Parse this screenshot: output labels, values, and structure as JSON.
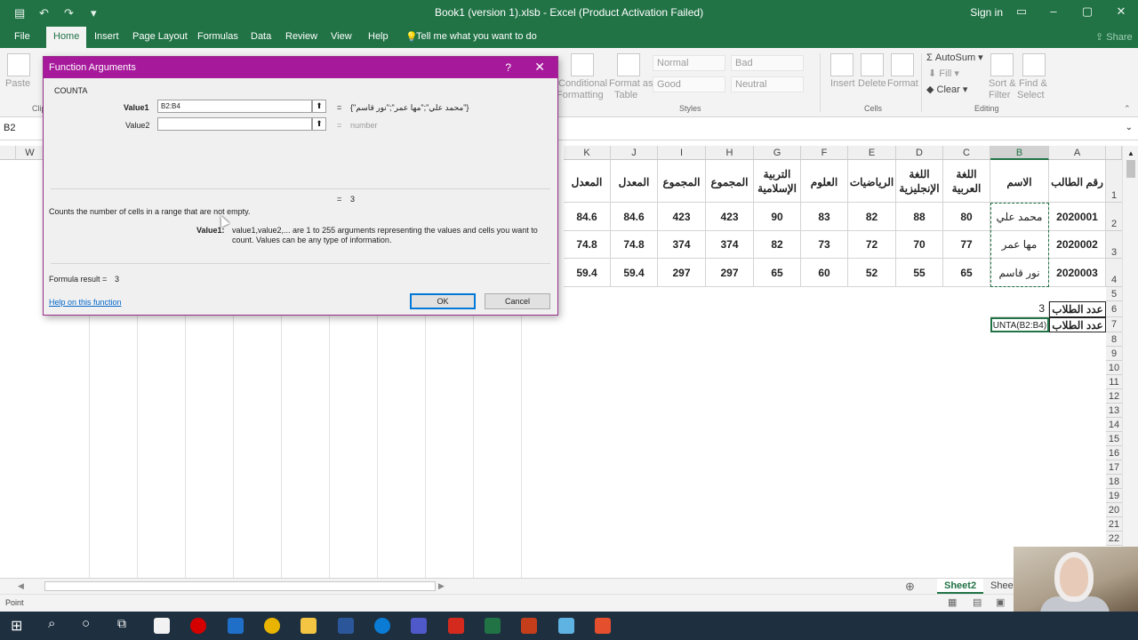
{
  "window": {
    "title": "Book1 (version 1).xlsb  -  Excel (Product Activation Failed)",
    "sign_in": "Sign in"
  },
  "ribbon": {
    "tabs": [
      "File",
      "Home",
      "Insert",
      "Page Layout",
      "Formulas",
      "Data",
      "Review",
      "View",
      "Help"
    ],
    "active_tab": "Home",
    "tell_me": "Tell me what you want to do",
    "share": "Share",
    "paste": "Paste",
    "clipboard_group": "Clip",
    "conditional": "Conditional",
    "formatting": "Formatting",
    "format_as": "Format as",
    "table": "Table",
    "styles": {
      "normal": "Normal",
      "bad": "Bad",
      "good": "Good",
      "neutral": "Neutral",
      "group": "Styles"
    },
    "insert": "Insert",
    "delete": "Delete",
    "format": "Format",
    "cells_group": "Cells",
    "autosum": "AutoSum",
    "fill": "Fill",
    "clear": "Clear",
    "sort_filter_1": "Sort &",
    "sort_filter_2": "Filter",
    "find_select_1": "Find &",
    "find_select_2": "Select",
    "editing_group": "Editing"
  },
  "formula_bar": {
    "name_box": "B2"
  },
  "grid": {
    "col_letters": [
      "W",
      "K",
      "J",
      "I",
      "H",
      "G",
      "F",
      "E",
      "D",
      "C",
      "B",
      "A"
    ],
    "row_numbers": [
      "1",
      "2",
      "3",
      "4",
      "5",
      "6",
      "7",
      "8",
      "9",
      "10",
      "11",
      "12",
      "13",
      "14",
      "15",
      "16",
      "17",
      "18",
      "19",
      "20",
      "21",
      "22"
    ],
    "headers": {
      "A": "رقم الطالب",
      "B": "الاسم",
      "C": "اللغة العربية",
      "D": "اللغة الإنجليزية",
      "E": "الرياضيات",
      "F": "العلوم",
      "G": "التربية الإسلامية",
      "H": "المجموع",
      "I": "المجموع",
      "J": "المعدل",
      "K": "المعدل"
    },
    "rows": [
      {
        "A": "2020001",
        "B": "محمد علي",
        "C": "80",
        "D": "88",
        "E": "82",
        "F": "83",
        "G": "90",
        "H": "423",
        "I": "423",
        "J": "84.6",
        "K": "84.6"
      },
      {
        "A": "2020002",
        "B": "مها عمر",
        "C": "77",
        "D": "70",
        "E": "72",
        "F": "73",
        "G": "82",
        "H": "374",
        "I": "374",
        "J": "74.8",
        "K": "74.8"
      },
      {
        "A": "2020003",
        "B": "نور قاسم",
        "C": "65",
        "D": "55",
        "E": "52",
        "F": "60",
        "G": "65",
        "H": "297",
        "I": "297",
        "J": "59.4",
        "K": "59.4"
      }
    ],
    "row6": {
      "A": "عدد الطلاب",
      "B": "3"
    },
    "row7": {
      "A": "عدد الطلاب",
      "B": "UNTA(B2:B4)"
    }
  },
  "dialog": {
    "title": "Function Arguments",
    "help_glyph": "?",
    "close_glyph": "✕",
    "function_name": "COUNTA",
    "value1_label": "Value1",
    "value1_input": "B2:B4",
    "value1_result": "{\"محمد علي\";\"مها عمر\";\"نور قاسم\"}",
    "value2_label": "Value2",
    "value2_input": "",
    "value2_result": "number",
    "equals": "=",
    "func_result": "3",
    "description": "Counts the number of cells in a range that are not empty.",
    "arg_label": "Value1:",
    "arg_description": "value1,value2,... are 1 to 255 arguments representing the values and cells you want to count. Values can be any type of information.",
    "formula_result_label": "Formula result =",
    "formula_result_value": "3",
    "help_link": "Help on this function",
    "ok": "OK",
    "cancel": "Cancel"
  },
  "sheets": {
    "active": "Sheet2",
    "next": "Shee"
  },
  "status": {
    "mode": "Point"
  },
  "colors": {
    "excel_green": "#217346",
    "dialog_purple": "#a6199b",
    "taskbar": "#1e2f3f"
  }
}
